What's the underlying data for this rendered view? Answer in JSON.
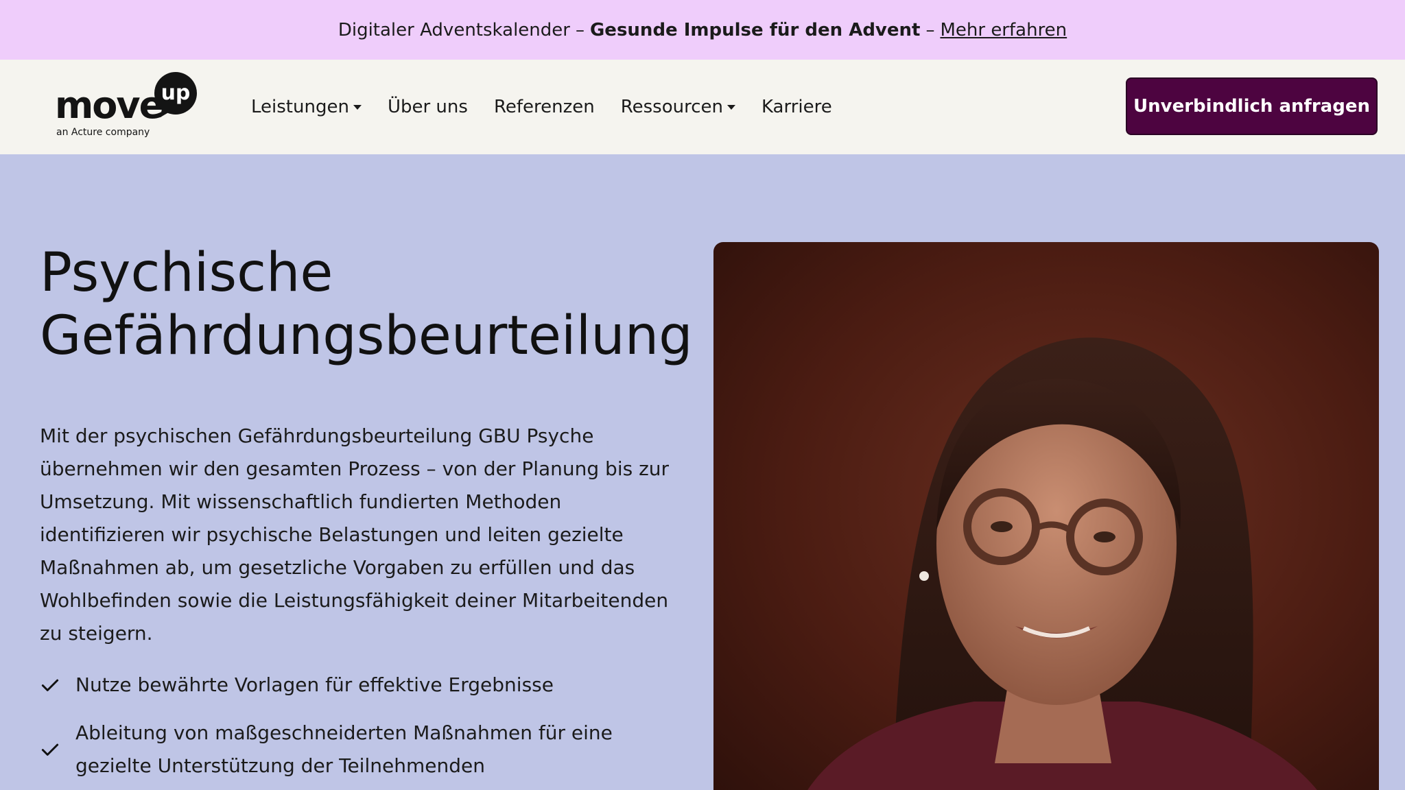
{
  "announcement": {
    "prefix": "Digitaler Adventskalender",
    "dash1": "–",
    "highlight": "Gesunde Impulse für den Advent",
    "dash2": "–",
    "link": "Mehr erfahren"
  },
  "header": {
    "logo": {
      "word": "move",
      "bubble": "up",
      "tagline": "an Acture company"
    },
    "nav": [
      {
        "label": "Leistungen",
        "dropdown": true
      },
      {
        "label": "Über uns",
        "dropdown": false
      },
      {
        "label": "Referenzen",
        "dropdown": false
      },
      {
        "label": "Ressourcen",
        "dropdown": true
      },
      {
        "label": "Karriere",
        "dropdown": false
      }
    ],
    "cta": "Unverbindlich anfragen"
  },
  "hero": {
    "title_line1": "Psychische",
    "title_line2": "Gefährdungsbeurteilung",
    "intro": "Mit der psychischen Gefährdungsbeurteilung GBU Psyche übernehmen wir den gesamten Prozess – von der Planung bis zur Umsetzung. Mit wissenschaftlich fundierten Methoden identifizieren wir psychische Belastungen und leiten gezielte Maßnahmen ab, um gesetzliche Vorgaben zu erfüllen und das Wohlbefinden sowie die Leistungsfähigkeit deiner Mitarbeitenden zu steigern.",
    "checks": [
      "Nutze bewährte Vorlagen für effektive Ergebnisse",
      "Ableitung von maßgeschneiderten Maßnahmen für eine gezielte Unterstützung der Teilnehmenden"
    ]
  },
  "colors": {
    "announcement_bg": "#efcdfb",
    "header_bg": "#f5f4ef",
    "page_bg": "#bfc5e6",
    "cta_bg": "#4d0440"
  },
  "icons": {
    "check": "check-icon",
    "caret": "chevron-down-icon"
  }
}
